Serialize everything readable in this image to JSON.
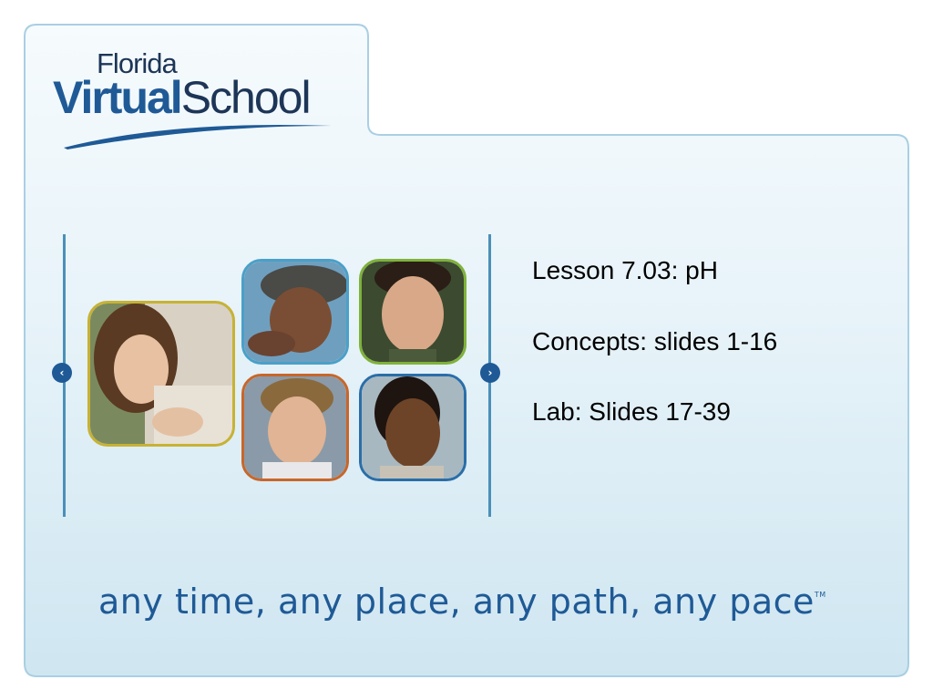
{
  "logo": {
    "florida": "Florida",
    "virtual": "Virtual",
    "school": "School"
  },
  "lesson": {
    "title": "Lesson 7.03:  pH",
    "concepts": "Concepts: slides 1-16",
    "lab": "Lab: Slides 17-39"
  },
  "tagline": {
    "text": "any time, any place, any path, any pace",
    "tm": "TM"
  },
  "nav": {
    "prev_icon": "chevron-left-icon",
    "next_icon": "chevron-right-icon"
  },
  "colors": {
    "brand_blue": "#1f5a96",
    "panel_border": "#a9cfe3",
    "panel_bg_top": "#f3f9fc",
    "panel_bg_bottom": "#cfe6f1"
  }
}
